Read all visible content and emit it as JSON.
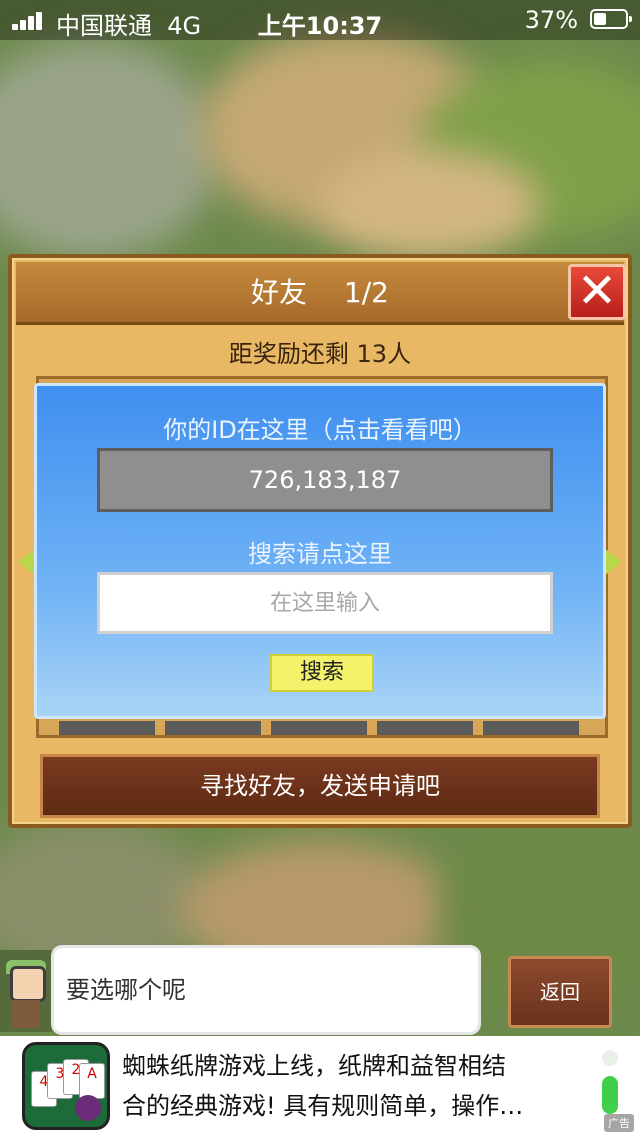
{
  "status_bar": {
    "carrier": "中国联通",
    "network": "4G",
    "time": "上午10:37",
    "battery": "37%"
  },
  "panel": {
    "title": "好友",
    "page": "1/2",
    "close_label": "✕",
    "remaining": "距奖励还剩 13人",
    "find_friends": "寻找好友，发送申请吧"
  },
  "search_dialog": {
    "id_label": "你的ID在这里（点击看看吧）",
    "id_value": "726,183,187",
    "search_label": "搜索请点这里",
    "search_placeholder": "在这里输入",
    "search_value": "",
    "search_button": "搜索"
  },
  "bottom": {
    "speech": "要选哪个呢",
    "back_button": "返回"
  },
  "ad": {
    "line1": "蜘蛛纸牌游戏上线，纸牌和益智相结",
    "line2": "合的经典游戏! 具有规则简单，操作…",
    "tag": "广告",
    "cards": [
      "4",
      "3",
      "2",
      "A"
    ]
  },
  "colors": {
    "dialog_blue": "#3f8ff0",
    "panel_wood": "#e8b865",
    "search_button": "#f3f26a",
    "close_red": "#e84a3a"
  }
}
